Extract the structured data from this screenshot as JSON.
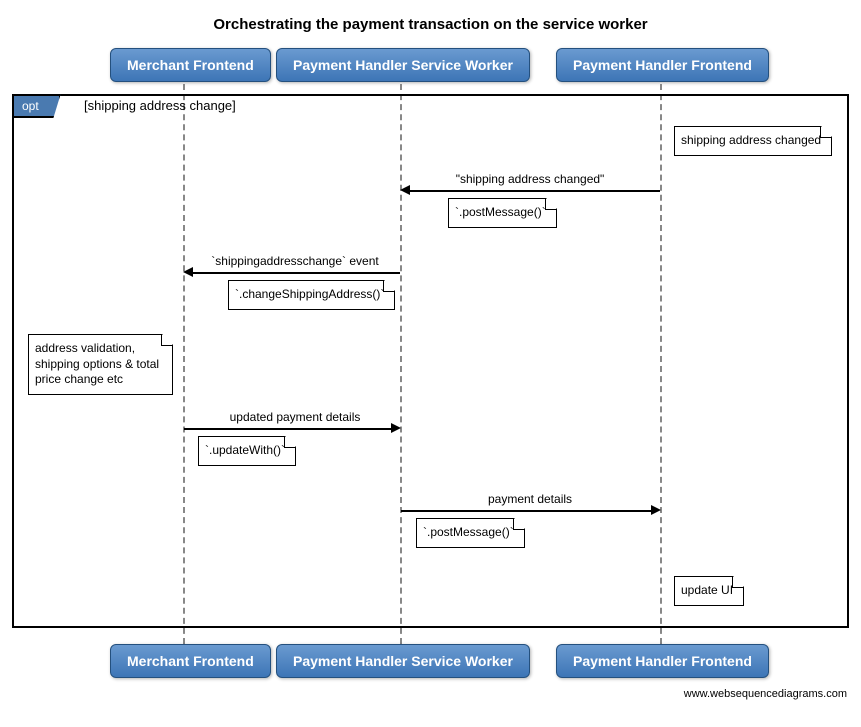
{
  "title": "Orchestrating the payment transaction on the service worker",
  "participants": {
    "p1": "Merchant Frontend",
    "p2": "Payment Handler Service Worker",
    "p3": "Payment Handler Frontend"
  },
  "frame": {
    "type": "opt",
    "guard": "[shipping address change]"
  },
  "notes": {
    "n1": "shipping address changed",
    "n2": "`.postMessage()`",
    "n3": "`.changeShippingAddress()`",
    "n4": "address validation, shipping options & total price change etc",
    "n5": "`.updateWith()`",
    "n6": "`.postMessage()`",
    "n7": "update UI"
  },
  "messages": {
    "m1": "\"shipping address changed\"",
    "m2": "`shippingaddresschange` event",
    "m3": "updated payment details",
    "m4": "payment details"
  },
  "footer": "www.websequencediagrams.com"
}
